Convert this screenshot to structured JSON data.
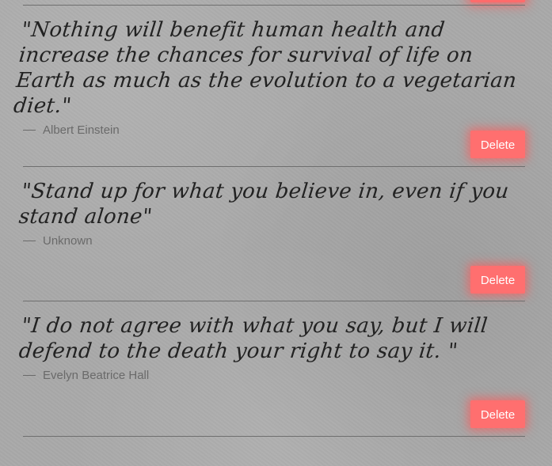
{
  "quotes": [
    {
      "text": "\"Nothing will benefit human health and increase the chances for survival of life on Earth as much as the evolution to a vegetarian diet.\"",
      "author": "Albert Einstein",
      "delete_label": "Delete"
    },
    {
      "text": "\"Stand up for what you believe in, even if you stand alone\"",
      "author": "Unknown",
      "delete_label": "Delete"
    },
    {
      "text": "\"I do not agree with what you say, but I will defend to the death your right to say it. \"",
      "author": "Evelyn Beatrice Hall",
      "delete_label": "Delete"
    }
  ],
  "colors": {
    "background": "#a9a9a9",
    "delete_button": "#ff6f6f",
    "rule": "#6f6f6f",
    "quote_text": "#222222",
    "author_text": "#6a6a6a"
  }
}
